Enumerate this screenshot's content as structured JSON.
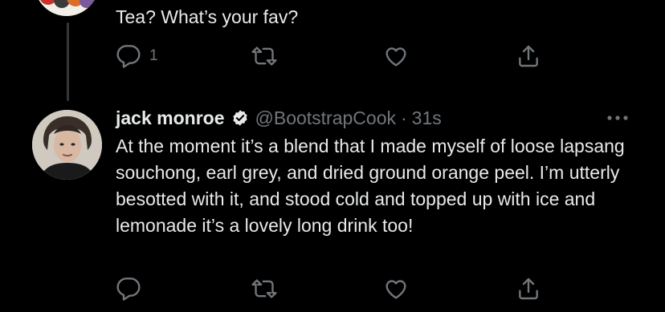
{
  "parent_tweet": {
    "text": "Tea? What’s your fav?",
    "actions": {
      "reply_count": "1"
    }
  },
  "reply_tweet": {
    "author_name": "jack monroe",
    "handle": "@BootstrapCook",
    "separator": "·",
    "timestamp": "31s",
    "text": "At the moment it’s a blend that I made myself of loose lapsang souchong, earl grey, and dried ground orange peel. I’m utterly besotted with it, and stood cold and topped up with ice and lemonade it’s a lovely long drink too!"
  },
  "icons": [
    "reply-icon",
    "retweet-icon",
    "like-icon",
    "share-icon",
    "verified-badge-icon",
    "more-options-icon"
  ],
  "colors": {
    "background": "#000000",
    "text_primary": "#e7e9ea",
    "text_secondary": "#71767b",
    "thread_line": "#333639"
  }
}
